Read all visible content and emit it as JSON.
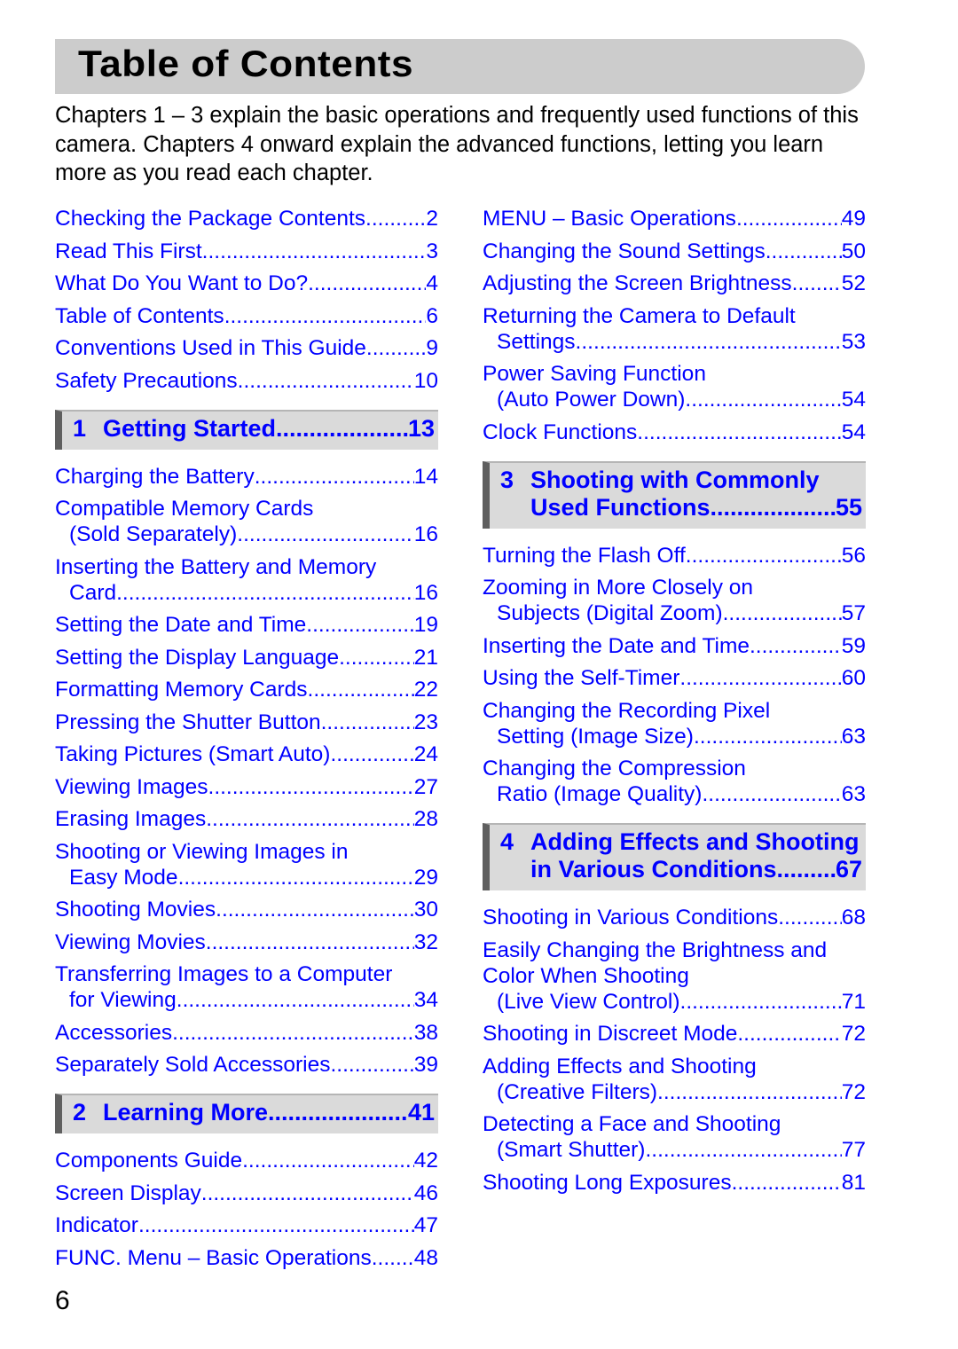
{
  "title": "Table of Contents",
  "intro": "Chapters 1 – 3 explain the basic operations and frequently used functions of this camera. Chapters 4 onward explain the advanced functions, letting you learn more as you read each chapter.",
  "left_column": {
    "front": [
      {
        "lines": [
          "Checking the Package Contents"
        ],
        "page": "2"
      },
      {
        "lines": [
          "Read This First"
        ],
        "page": "3"
      },
      {
        "lines": [
          "What Do You Want to Do?"
        ],
        "page": "4"
      },
      {
        "lines": [
          "Table of Contents"
        ],
        "page": "6"
      },
      {
        "lines": [
          "Conventions Used in This Guide"
        ],
        "page": "9"
      },
      {
        "lines": [
          "Safety Precautions"
        ],
        "page": "10"
      }
    ],
    "chapter1": {
      "number": "1",
      "lines": [
        "Getting Started"
      ],
      "page": "13"
    },
    "chapter1_entries": [
      {
        "lines": [
          "Charging the Battery"
        ],
        "page": "14"
      },
      {
        "lines": [
          "Compatible Memory Cards",
          "(Sold Separately)"
        ],
        "page": "16"
      },
      {
        "lines": [
          "Inserting the Battery and Memory",
          "Card"
        ],
        "page": "16"
      },
      {
        "lines": [
          "Setting the Date and Time"
        ],
        "page": "19"
      },
      {
        "lines": [
          "Setting the Display Language"
        ],
        "page": "21"
      },
      {
        "lines": [
          "Formatting Memory Cards"
        ],
        "page": "22"
      },
      {
        "lines": [
          "Pressing the Shutter Button"
        ],
        "page": "23"
      },
      {
        "lines": [
          "Taking Pictures (Smart Auto)"
        ],
        "page": "24"
      },
      {
        "lines": [
          "Viewing Images"
        ],
        "page": "27"
      },
      {
        "lines": [
          "Erasing Images"
        ],
        "page": "28"
      },
      {
        "lines": [
          "Shooting or Viewing Images in",
          "Easy Mode"
        ],
        "page": "29"
      },
      {
        "lines": [
          "Shooting Movies"
        ],
        "page": "30"
      },
      {
        "lines": [
          "Viewing Movies"
        ],
        "page": "32"
      },
      {
        "lines": [
          "Transferring Images to a Computer",
          "for Viewing"
        ],
        "page": "34"
      },
      {
        "lines": [
          "Accessories"
        ],
        "page": "38"
      },
      {
        "lines": [
          "Separately Sold Accessories"
        ],
        "page": "39"
      }
    ],
    "chapter2": {
      "number": "2",
      "lines": [
        "Learning More"
      ],
      "page": "41"
    },
    "chapter2_entries": [
      {
        "lines": [
          "Components Guide"
        ],
        "page": "42"
      },
      {
        "lines": [
          "Screen Display"
        ],
        "page": "46"
      },
      {
        "lines": [
          "Indicator"
        ],
        "page": "47"
      },
      {
        "lines": [
          "FUNC. Menu – Basic Operations"
        ],
        "page": "48"
      }
    ]
  },
  "right_column": {
    "chapter2_cont": [
      {
        "lines": [
          "MENU – Basic Operations"
        ],
        "page": "49"
      },
      {
        "lines": [
          "Changing the Sound Settings"
        ],
        "page": "50"
      },
      {
        "lines": [
          "Adjusting the Screen Brightness"
        ],
        "page": "52"
      },
      {
        "lines": [
          "Returning the Camera to Default",
          "Settings"
        ],
        "page": "53"
      },
      {
        "lines": [
          "Power Saving Function",
          "(Auto Power Down)"
        ],
        "page": "54"
      },
      {
        "lines": [
          "Clock Functions"
        ],
        "page": "54"
      }
    ],
    "chapter3": {
      "number": "3",
      "lines": [
        "Shooting with Commonly",
        "Used Functions"
      ],
      "page": "55"
    },
    "chapter3_entries": [
      {
        "lines": [
          "Turning the Flash Off"
        ],
        "page": "56"
      },
      {
        "lines": [
          "Zooming in More Closely on",
          "Subjects (Digital Zoom)"
        ],
        "page": "57"
      },
      {
        "lines": [
          "Inserting the Date and Time"
        ],
        "page": "59"
      },
      {
        "lines": [
          "Using the Self-Timer"
        ],
        "page": "60"
      },
      {
        "lines": [
          "Changing the Recording Pixel",
          "Setting (Image Size)"
        ],
        "page": "63"
      },
      {
        "lines": [
          "Changing the Compression",
          "Ratio (Image Quality)"
        ],
        "page": "63"
      }
    ],
    "chapter4": {
      "number": "4",
      "lines": [
        "Adding Effects and Shooting",
        "in Various Conditions"
      ],
      "page": "67"
    },
    "chapter4_entries": [
      {
        "lines": [
          "Shooting in Various Conditions"
        ],
        "page": "68"
      },
      {
        "lines": [
          "Easily Changing the Brightness and",
          "Color When Shooting",
          "(Live View Control)"
        ],
        "page": "71"
      },
      {
        "lines": [
          "Shooting in Discreet Mode"
        ],
        "page": "72"
      },
      {
        "lines": [
          "Adding Effects and Shooting",
          "(Creative Filters)"
        ],
        "page": "72"
      },
      {
        "lines": [
          "Detecting a Face and Shooting",
          "(Smart Shutter)"
        ],
        "page": "77"
      },
      {
        "lines": [
          "Shooting Long Exposures"
        ],
        "page": "81"
      }
    ]
  },
  "page_number": "6"
}
